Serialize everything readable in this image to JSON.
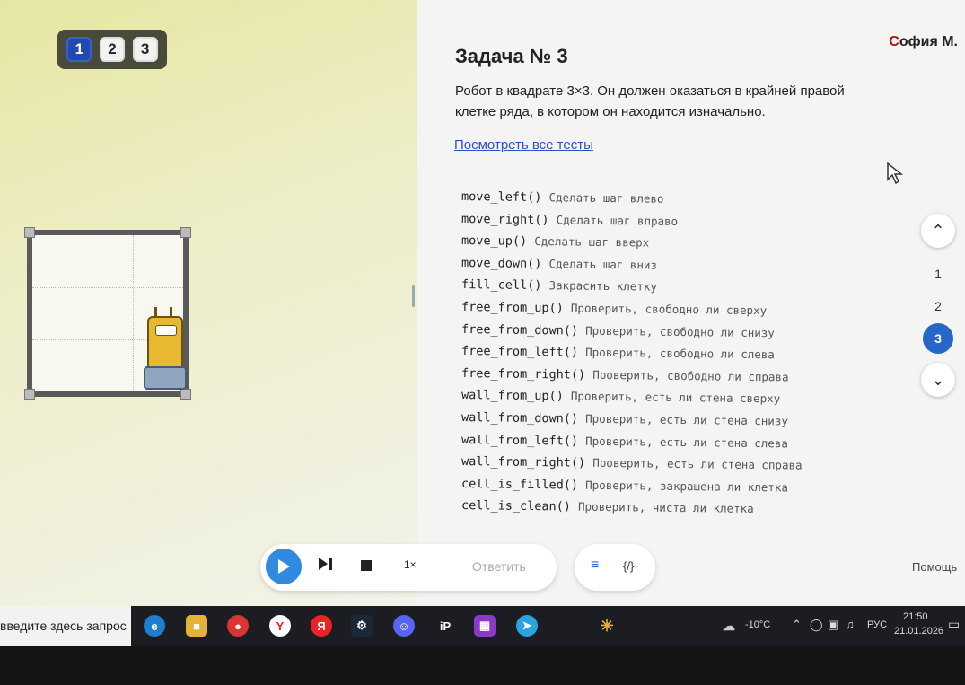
{
  "level_tabs": [
    "1",
    "2",
    "3"
  ],
  "active_level": "1",
  "user": {
    "name": "София М.",
    "initial": "С",
    "rest": "офия М."
  },
  "task": {
    "title": "Задача № 3",
    "description": "Робот в квадрате 3×3. Он должен оказаться в крайней правой клетке ряда, в котором он находится изначально.",
    "tests_link": "Посмотреть все тесты"
  },
  "commands": [
    {
      "fn": "move_left()",
      "desc": "Сделать шаг влево"
    },
    {
      "fn": "move_right()",
      "desc": "Сделать шаг вправо"
    },
    {
      "fn": "move_up()",
      "desc": "Сделать шаг вверх"
    },
    {
      "fn": "move_down()",
      "desc": "Сделать шаг вниз"
    },
    {
      "fn": "fill_cell()",
      "desc": "Закрасить клетку"
    },
    {
      "fn": "free_from_up()",
      "desc": "Проверить, свободно ли сверху"
    },
    {
      "fn": "free_from_down()",
      "desc": "Проверить, свободно ли снизу"
    },
    {
      "fn": "free_from_left()",
      "desc": "Проверить, свободно ли слева"
    },
    {
      "fn": "free_from_right()",
      "desc": "Проверить, свободно ли справа"
    },
    {
      "fn": "wall_from_up()",
      "desc": "Проверить, есть ли стена сверху"
    },
    {
      "fn": "wall_from_down()",
      "desc": "Проверить, есть ли стена снизу"
    },
    {
      "fn": "wall_from_left()",
      "desc": "Проверить, есть ли стена слева"
    },
    {
      "fn": "wall_from_right()",
      "desc": "Проверить, есть ли стена справа"
    },
    {
      "fn": "cell_is_filled()",
      "desc": "Проверить, закрашена ли клетка"
    },
    {
      "fn": "cell_is_clean()",
      "desc": "Проверить, чиста ли клетка"
    }
  ],
  "task_nav": {
    "numbers": [
      "1",
      "2",
      "3"
    ],
    "active": "3"
  },
  "controls": {
    "speed": "1×",
    "answer": "Ответить",
    "help": "Помощь"
  },
  "taskbar": {
    "search_text": "введите здесь запрос",
    "weather": "-10°C",
    "lang": "РУС",
    "time": "21:50",
    "date": "21.01.2026"
  },
  "colors": {
    "accent": "#2f8ae0",
    "active_tab": "#2348b0",
    "link": "#2f4fc8"
  }
}
